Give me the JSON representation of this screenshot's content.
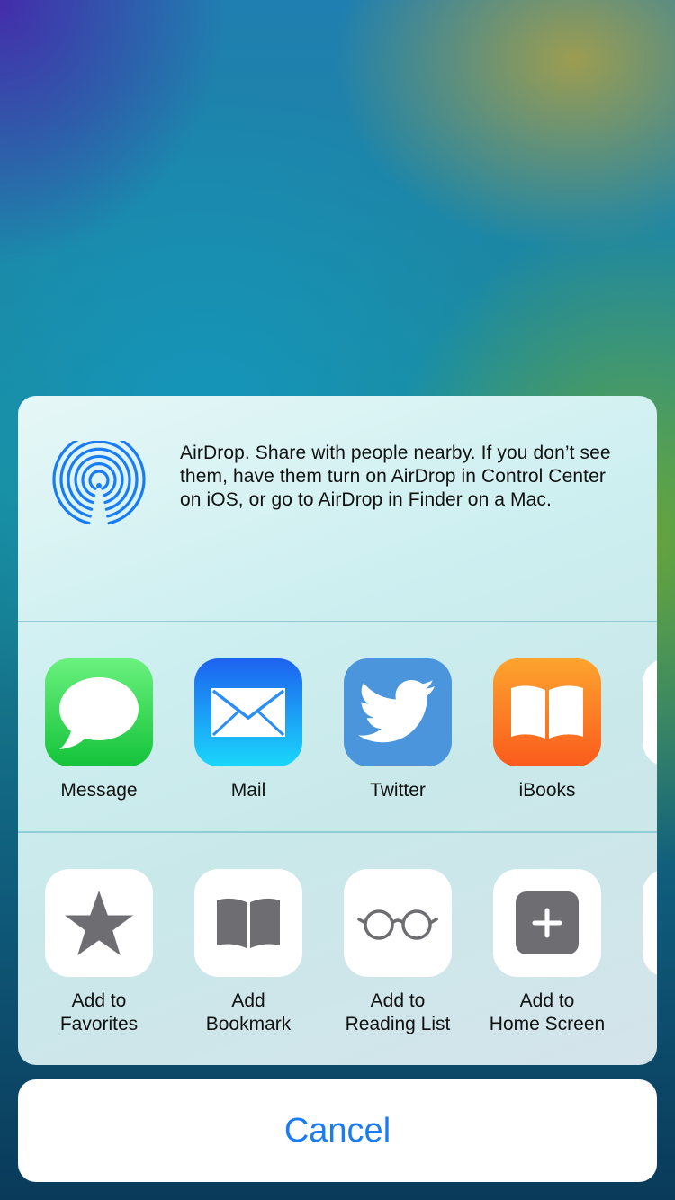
{
  "airdrop": {
    "icon": "airdrop-icon",
    "text": "AirDrop. Share with people nearby. If you don’t see them, have them turn on AirDrop in Control Center on iOS, or go to AirDrop in Finder on a Mac."
  },
  "apps": [
    {
      "label": "Message",
      "icon": "message-icon"
    },
    {
      "label": "Mail",
      "icon": "mail-icon"
    },
    {
      "label": "Twitter",
      "icon": "twitter-icon"
    },
    {
      "label": "iBooks",
      "icon": "ibooks-icon"
    }
  ],
  "actions": [
    {
      "label": "Add to Favorites",
      "line1": "Add to",
      "line2": "Favorites",
      "icon": "star-icon"
    },
    {
      "label": "Add Bookmark",
      "line1": "Add",
      "line2": "Bookmark",
      "icon": "book-icon"
    },
    {
      "label": "Add to Reading List",
      "line1": "Add to",
      "line2": "Reading List",
      "icon": "glasses-icon"
    },
    {
      "label": "Add to Home Screen",
      "line1": "Add to",
      "line2": "Home Screen",
      "icon": "plus-icon"
    }
  ],
  "cancel": {
    "label": "Cancel"
  },
  "colors": {
    "accent": "#1a7cf5",
    "icon_gray": "#6d6d72"
  }
}
